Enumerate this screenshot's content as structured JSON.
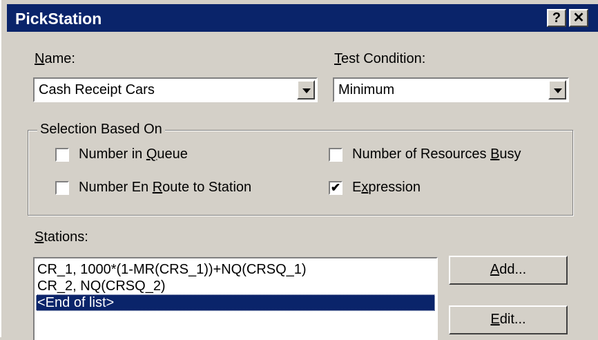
{
  "window": {
    "title": "PickStation",
    "help_glyph": "?",
    "close_glyph": "✕"
  },
  "name_field": {
    "label_underlined": "N",
    "label_rest": "ame:",
    "value": "Cash Receipt   Cars"
  },
  "test_condition": {
    "label_underlined": "T",
    "label_rest": "est Condition:",
    "value": "Minimum"
  },
  "selection": {
    "group_title": "Selection Based On",
    "options": [
      {
        "pre": "Number in ",
        "u": "Q",
        "post": "ueue",
        "checked": false
      },
      {
        "pre": "Number of Resources ",
        "u": "B",
        "post": "usy",
        "checked": false
      },
      {
        "pre": "Number En ",
        "u": "R",
        "post": "oute to Station",
        "checked": false
      },
      {
        "pre": "E",
        "u": "x",
        "post": "pression",
        "checked": true
      }
    ],
    "check_mark": "✔"
  },
  "stations": {
    "label_underlined": "S",
    "label_rest": "tations:",
    "items": [
      "CR_1, 1000*(1-MR(CRS_1))+NQ(CRSQ_1)",
      "CR_2, NQ(CRSQ_2)",
      "<End of list>"
    ],
    "selected_index": 2
  },
  "buttons": {
    "add": {
      "u": "A",
      "rest": "dd..."
    },
    "edit": {
      "u": "E",
      "rest": "dit..."
    }
  }
}
